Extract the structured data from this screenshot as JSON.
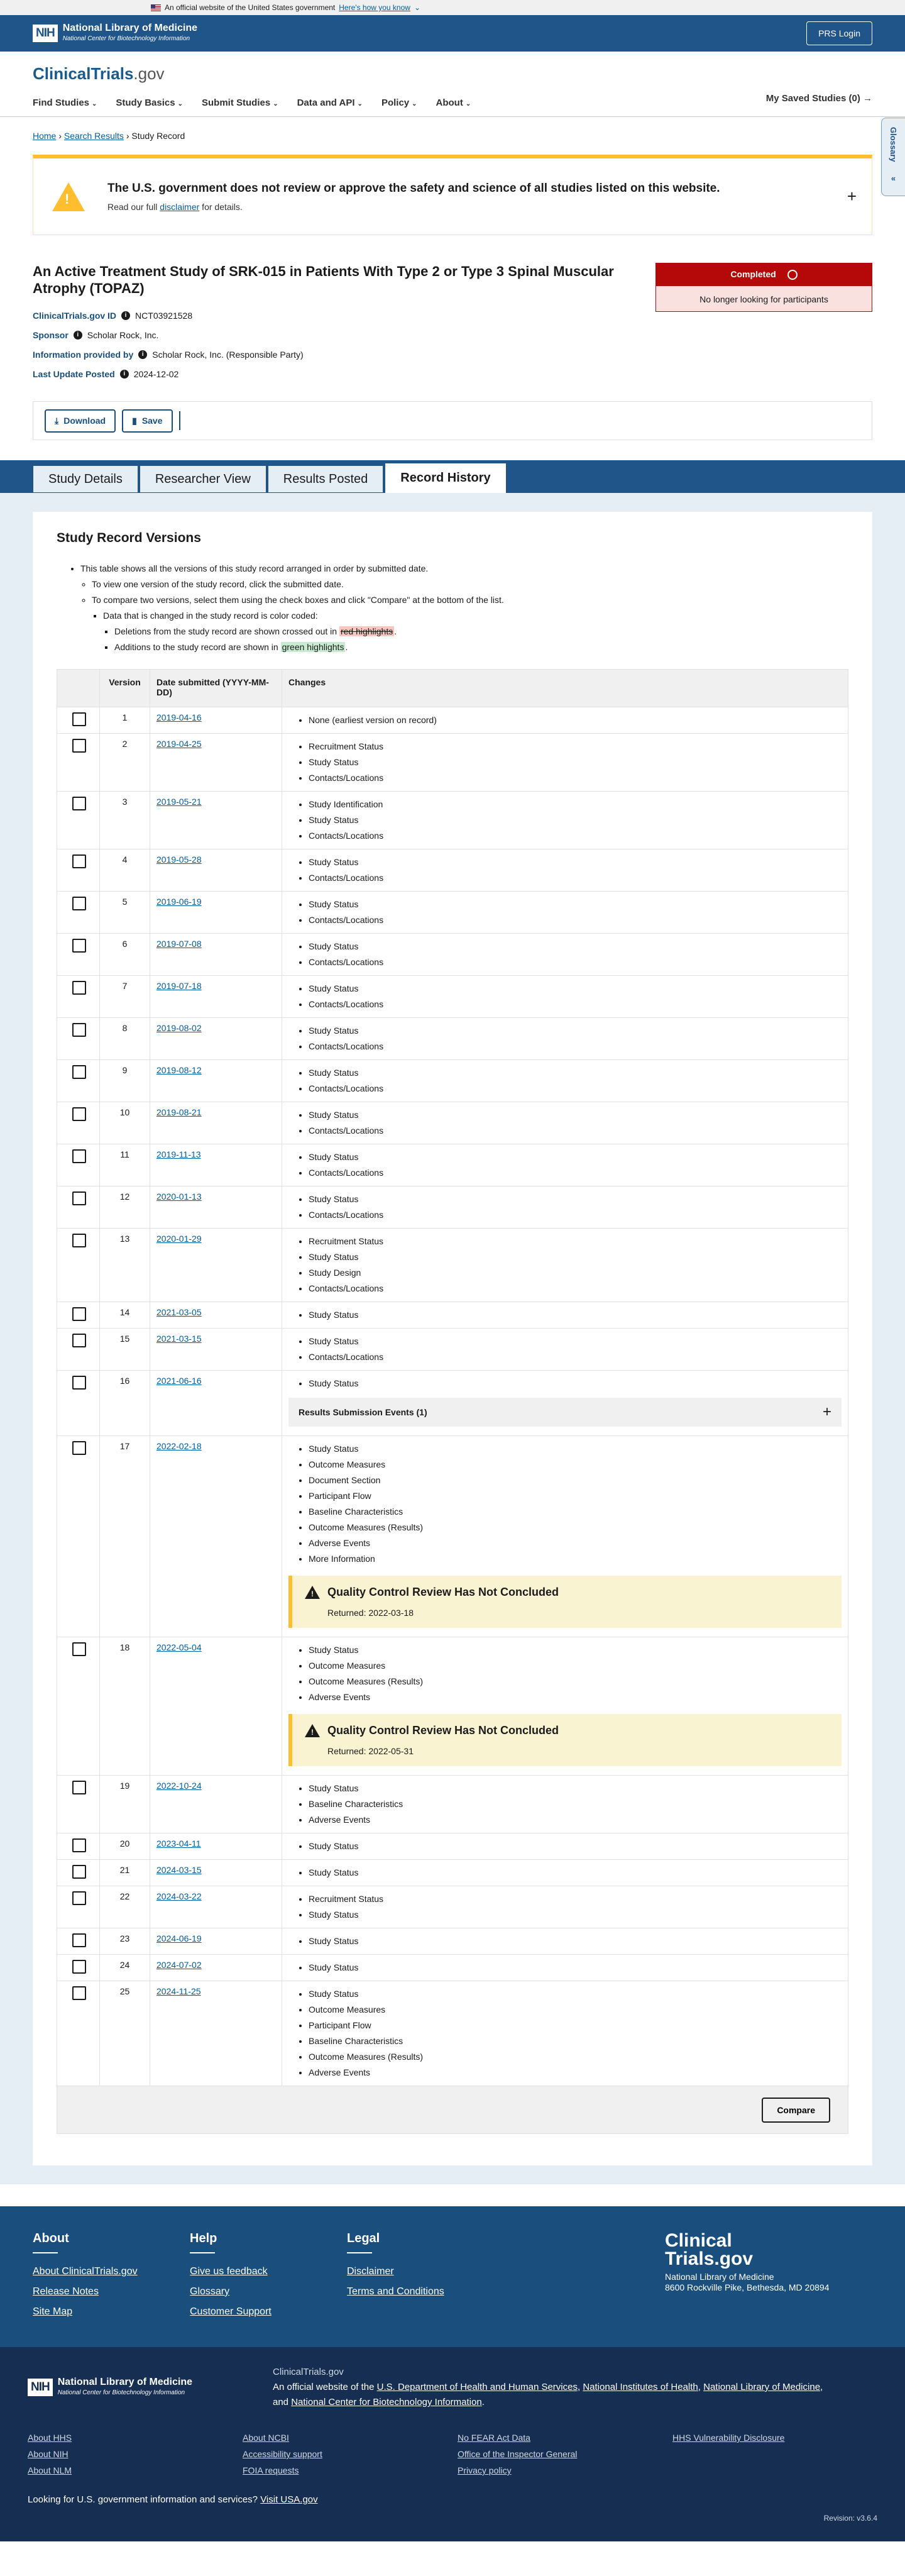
{
  "gov_banner": {
    "text": "An official website of the United States government",
    "link": "Here's how you know"
  },
  "nih": {
    "abbr": "NIH",
    "name": "National Library of Medicine",
    "sub": "National Center for Biotechnology Information",
    "prs_login": "PRS Login"
  },
  "site": {
    "logo_main": "ClinicalTrials",
    "logo_suffix": ".gov",
    "saved": "My Saved Studies (0) →"
  },
  "nav": [
    "Find Studies",
    "Study Basics",
    "Submit Studies",
    "Data and API",
    "Policy",
    "About"
  ],
  "glossary": "Glossary",
  "breadcrumb": {
    "home": "Home",
    "search": "Search Results",
    "current": "Study Record"
  },
  "disclaimer": {
    "title": "The U.S. government does not review or approve the safety and science of all studies listed on this website.",
    "pre": "Read our full ",
    "link": "disclaimer",
    "post": " for details."
  },
  "study": {
    "title": "An Active Treatment Study of SRK-015 in Patients With Type 2 or Type 3 Spinal Muscular Atrophy (TOPAZ)",
    "id_label": "ClinicalTrials.gov ID",
    "id": "NCT03921528",
    "sponsor_label": "Sponsor",
    "sponsor": "Scholar Rock, Inc.",
    "info_label": "Information provided by",
    "info": "Scholar Rock, Inc. (Responsible Party)",
    "update_label": "Last Update Posted",
    "update": "2024-12-02",
    "status": "Completed",
    "status_sub": "No longer looking for participants"
  },
  "toolbar": {
    "download": "Download",
    "save": "Save"
  },
  "tabs": [
    "Study Details",
    "Researcher View",
    "Results Posted",
    "Record History"
  ],
  "record": {
    "heading": "Study Record Versions",
    "intro": "This table shows all the versions of this study record arranged in order by submitted date.",
    "b1": "To view one version of the study record, click the submitted date.",
    "b2": "To compare two versions, select them using the check boxes and click \"Compare\" at the bottom of the list.",
    "b3": "Data that is changed in the study record is color coded:",
    "b4_pre": "Deletions from the study record are shown crossed out in ",
    "b4_hl": "red highlights",
    "b4_post": ".",
    "b5_pre": "Additions to the study record are shown in ",
    "b5_hl": "green highlights",
    "b5_post": ".",
    "col_version": "Version",
    "col_date": "Date submitted (YYYY-MM-DD)",
    "col_changes": "Changes",
    "compare": "Compare",
    "rows": [
      {
        "v": "1",
        "d": "2019-04-16",
        "c": [
          "None (earliest version on record)"
        ]
      },
      {
        "v": "2",
        "d": "2019-04-25",
        "c": [
          "Recruitment Status",
          "Study Status",
          "Contacts/Locations"
        ]
      },
      {
        "v": "3",
        "d": "2019-05-21",
        "c": [
          "Study Identification",
          "Study Status",
          "Contacts/Locations"
        ]
      },
      {
        "v": "4",
        "d": "2019-05-28",
        "c": [
          "Study Status",
          "Contacts/Locations"
        ]
      },
      {
        "v": "5",
        "d": "2019-06-19",
        "c": [
          "Study Status",
          "Contacts/Locations"
        ]
      },
      {
        "v": "6",
        "d": "2019-07-08",
        "c": [
          "Study Status",
          "Contacts/Locations"
        ]
      },
      {
        "v": "7",
        "d": "2019-07-18",
        "c": [
          "Study Status",
          "Contacts/Locations"
        ]
      },
      {
        "v": "8",
        "d": "2019-08-02",
        "c": [
          "Study Status",
          "Contacts/Locations"
        ]
      },
      {
        "v": "9",
        "d": "2019-08-12",
        "c": [
          "Study Status",
          "Contacts/Locations"
        ]
      },
      {
        "v": "10",
        "d": "2019-08-21",
        "c": [
          "Study Status",
          "Contacts/Locations"
        ]
      },
      {
        "v": "11",
        "d": "2019-11-13",
        "c": [
          "Study Status",
          "Contacts/Locations"
        ]
      },
      {
        "v": "12",
        "d": "2020-01-13",
        "c": [
          "Study Status",
          "Contacts/Locations"
        ]
      },
      {
        "v": "13",
        "d": "2020-01-29",
        "c": [
          "Recruitment Status",
          "Study Status",
          "Study Design",
          "Contacts/Locations"
        ]
      },
      {
        "v": "14",
        "d": "2021-03-05",
        "c": [
          "Study Status"
        ]
      },
      {
        "v": "15",
        "d": "2021-03-15",
        "c": [
          "Study Status",
          "Contacts/Locations"
        ]
      },
      {
        "v": "16",
        "d": "2021-06-16",
        "c": [
          "Study Status"
        ],
        "box": "Results Submission Events (1)"
      },
      {
        "v": "17",
        "d": "2022-02-18",
        "c": [
          "Study Status",
          "Outcome Measures",
          "Document Section",
          "Participant Flow",
          "Baseline Characteristics",
          "Outcome Measures (Results)",
          "Adverse Events",
          "More Information"
        ],
        "qc": {
          "title": "Quality Control Review Has Not Concluded",
          "ret": "Returned: 2022-03-18"
        }
      },
      {
        "v": "18",
        "d": "2022-05-04",
        "c": [
          "Study Status",
          "Outcome Measures",
          "Outcome Measures (Results)",
          "Adverse Events"
        ],
        "qc": {
          "title": "Quality Control Review Has Not Concluded",
          "ret": "Returned: 2022-05-31"
        }
      },
      {
        "v": "19",
        "d": "2022-10-24",
        "c": [
          "Study Status",
          "Baseline Characteristics",
          "Adverse Events"
        ]
      },
      {
        "v": "20",
        "d": "2023-04-11",
        "c": [
          "Study Status"
        ]
      },
      {
        "v": "21",
        "d": "2024-03-15",
        "c": [
          "Study Status"
        ]
      },
      {
        "v": "22",
        "d": "2024-03-22",
        "c": [
          "Recruitment Status",
          "Study Status"
        ]
      },
      {
        "v": "23",
        "d": "2024-06-19",
        "c": [
          "Study Status"
        ]
      },
      {
        "v": "24",
        "d": "2024-07-02",
        "c": [
          "Study Status"
        ]
      },
      {
        "v": "25",
        "d": "2024-11-25",
        "c": [
          "Study Status",
          "Outcome Measures",
          "Participant Flow",
          "Baseline Characteristics",
          "Outcome Measures (Results)",
          "Adverse Events"
        ]
      }
    ]
  },
  "footer": {
    "about_h": "About",
    "about": [
      "About ClinicalTrials.gov",
      "Release Notes",
      "Site Map"
    ],
    "help_h": "Help",
    "help": [
      "Give us feedback",
      "Glossary",
      "Customer Support"
    ],
    "legal_h": "Legal",
    "legal": [
      "Disclaimer",
      "Terms and Conditions"
    ],
    "logo": "Clinical Trials.gov",
    "addr1": "National Library of Medicine",
    "addr2": "8600 Rockville Pike, Bethesda, MD 20894",
    "ct": "ClinicalTrials.gov",
    "official_pre": "An official website of the ",
    "hhs": "U.S. Department of Health and Human Services",
    "nihl": "National Institutes of Health",
    "nlm": "National Library of Medicine",
    "ncbi": "National Center for Biotechnology Information",
    "links": [
      "About HHS",
      "About NCBI",
      "No FEAR Act Data",
      "HHS Vulnerability Disclosure",
      "About NIH",
      "Accessibility support",
      "Office of the Inspector General",
      "",
      "About NLM",
      "FOIA requests",
      "Privacy policy",
      ""
    ],
    "usagov_pre": "Looking for U.S. government information and services?",
    "usagov": "Visit USA.gov",
    "revision": "Revision: v3.6.4"
  }
}
